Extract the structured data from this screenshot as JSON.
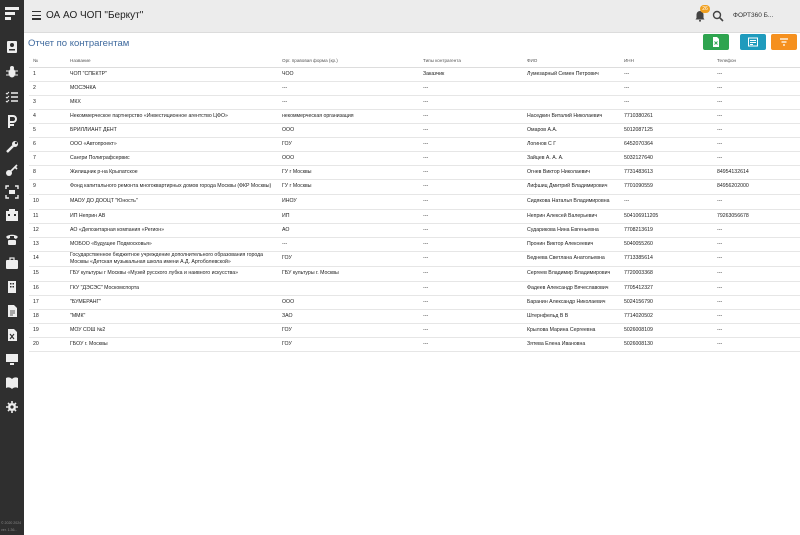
{
  "header": {
    "app_title": "ОА АО ЧОП \"Беркут\"",
    "notification_count": "26",
    "user_name": "ФОРТ360 Б..."
  },
  "sidebar": {
    "icons": [
      "logo-icon",
      "id-card-icon",
      "bug-icon",
      "checklist-icon",
      "ruble-icon",
      "wrench-icon",
      "key-icon",
      "scan-icon",
      "building-icon",
      "phone-icon",
      "briefcase-icon",
      "office-icon",
      "document-icon",
      "excel-icon",
      "monitor-icon",
      "book-icon",
      "settings-icon"
    ],
    "version_line1": "© 2020 2024",
    "version_line2": "ver. 1.36..."
  },
  "page": {
    "title": "Отчет по контрагентам"
  },
  "actions": {
    "export_icon": "excel-file-icon",
    "columns_icon": "columns-icon",
    "filter_icon": "filter-icon"
  },
  "table": {
    "columns": [
      "№",
      "Название",
      "Орг. правовая форма (кр.)",
      "Типы контрагента",
      "ФИО",
      "ИНН",
      "Телефон"
    ],
    "rows": [
      [
        "1",
        "ЧОП \"СПЕКТР\"",
        "ЧОО",
        "Заказчик",
        "Лумезарный Семен Петрович",
        "---",
        "---"
      ],
      [
        "2",
        "МОСЭНКА",
        "---",
        "---",
        "",
        "---",
        "---"
      ],
      [
        "3",
        "МКХ",
        "---",
        "---",
        "",
        "---",
        "---"
      ],
      [
        "4",
        "Некоммерческое партнерство «Инвестиционное агентство ЦФО»",
        "некоммерческая организация",
        "---",
        "Наседкин Виталий Николаевич",
        "7710380261",
        "---"
      ],
      [
        "5",
        "БРИЛЛИАНТ ДЕНТ",
        "ООО",
        "---",
        "Омаров А.А.",
        "5012087125",
        "---"
      ],
      [
        "6",
        "ООО «Автопроект»",
        "ГОУ",
        "---",
        "Логинов С Г",
        "6452070364",
        "---"
      ],
      [
        "7",
        "Сангри Полиграфсервис",
        "ООО",
        "---",
        "Зайцев А. А. А.",
        "5032127640",
        "---"
      ],
      [
        "8",
        "Жилищник р-на Крылатское",
        "ГУ г Москвы",
        "---",
        "Огнев Виктор Николаевич",
        "7731483613",
        "84954132614"
      ],
      [
        "9",
        "Фонд капитального ремонта многоквартирных домов города Москвы (ФКР Москвы)",
        "ГУ г Москвы",
        "---",
        "Лифшиц Дмитрий Владимирович",
        "7701090559",
        "84956202000"
      ],
      [
        "10",
        "МАОУ ДО ДООЦТ \"Юность\"",
        "ИНОУ",
        "---",
        "Сидякова Наталья Владимировна",
        "---",
        "---"
      ],
      [
        "11",
        "ИП Неприн АВ",
        "ИП",
        "---",
        "Неприн Алексей Валерьевич",
        "504106911205",
        "79263056678"
      ],
      [
        "12",
        "АО «Депозитарная компания «Регион»",
        "АО",
        "---",
        "Сударикова Нина Евгеньевна",
        "7708213619",
        "---"
      ],
      [
        "13",
        "МОБОО «Будущее Подмосковья»",
        "---",
        "---",
        "Пронин Виктор Алексеевич",
        "5040055260",
        "---"
      ],
      [
        "14",
        "Государственное бюджетное учреждение дополнительного образования города Москвы «Детская музыкальная школа имени А.Д. Артоболевской»",
        "ГОУ",
        "---",
        "Беднева Светлана Анатольевна",
        "7713385614",
        "---"
      ],
      [
        "15",
        "ГБУ культуры г Москвы «Музей русского лубка и наивного искусства»",
        "ГБУ культуры г. Москвы",
        "---",
        "Сергеев Владимир Владимирович",
        "7720003368",
        "---"
      ],
      [
        "16",
        "ГКУ \"ДЭСЭС\" Москомспорта",
        "",
        "---",
        "Фадеев Александр Вячеславович",
        "7705412327",
        "---"
      ],
      [
        "17",
        "\"БУМЕРАНГ\"",
        "ООО",
        "---",
        "Баранин Александр Николаевич",
        "5024156790",
        "---"
      ],
      [
        "18",
        "\"ММК\"",
        "ЗАО",
        "---",
        "Штернфельд В В",
        "7714020502",
        "---"
      ],
      [
        "19",
        "МОУ СОШ №2",
        "ГОУ",
        "---",
        "Крылова Марина Сергеевна",
        "5026008109",
        "---"
      ],
      [
        "20",
        "ГБОУ г. Москвы",
        "ГОУ",
        "---",
        "Зятева Елена Ивановна",
        "5026008130",
        "---"
      ]
    ]
  },
  "colors": {
    "sidebar_bg": "#2f2f2f",
    "topbar_bg": "#ececec",
    "title_blue": "#3f6a9e",
    "btn_green": "#2ea44f",
    "btn_teal": "#1f9bbd",
    "btn_orange": "#f5901e"
  }
}
